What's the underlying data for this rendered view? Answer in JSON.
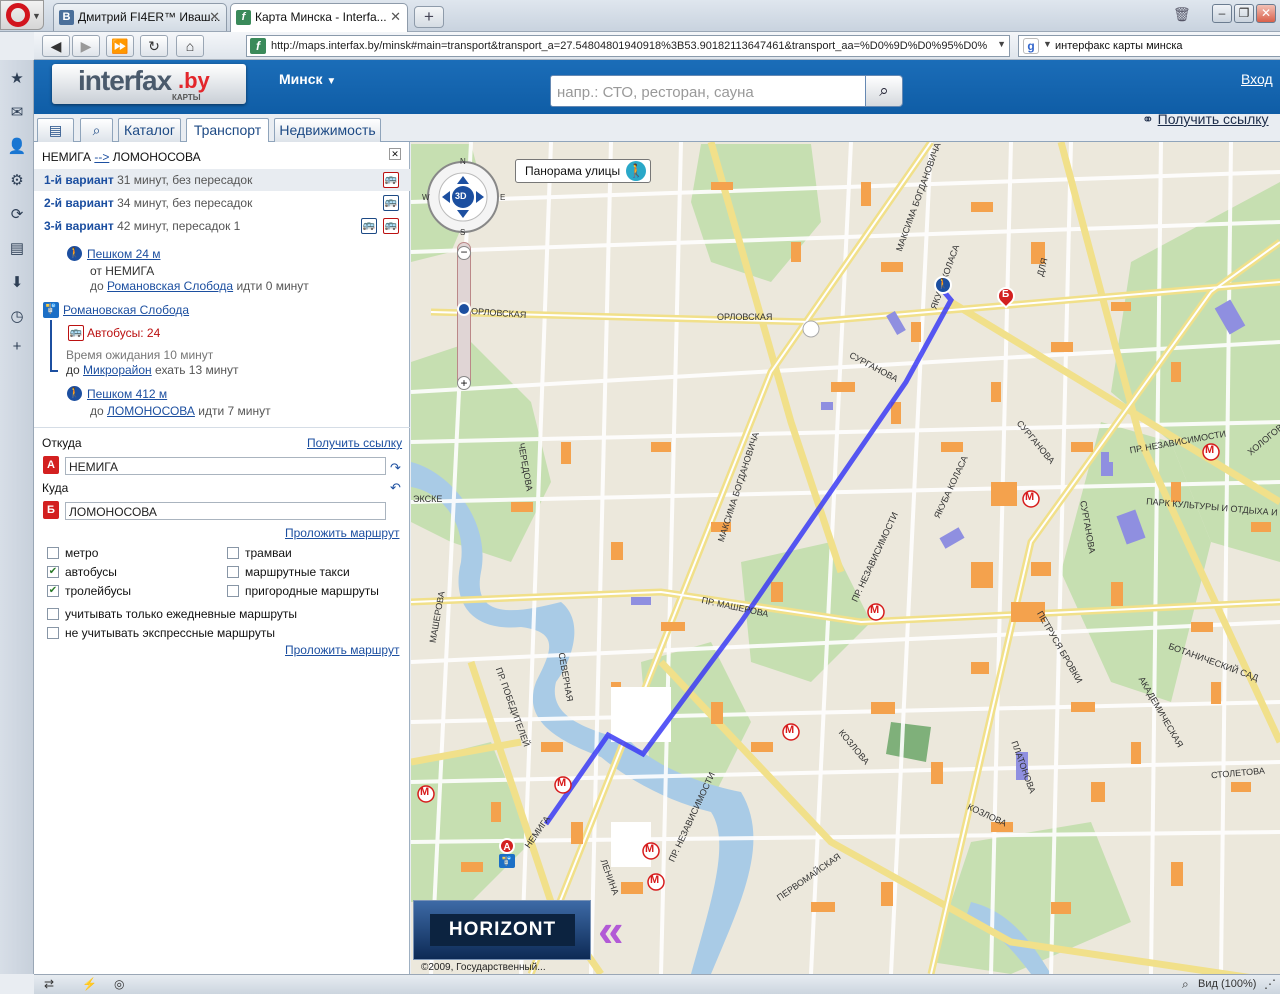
{
  "browser": {
    "tabs": [
      {
        "title": "Дмитрий FI4ER™ Иваш...",
        "favicon": "B"
      },
      {
        "title": "Карта Минска - Interfa...",
        "favicon": "f"
      }
    ],
    "new_tab": "+",
    "address": "http://maps.interfax.by/minsk#main=transport&transport_a=27.5480480194091​8%3B53.90182113647461&transport_aa=%D0%9D%D0%95%D0%",
    "search_query": "интерфакс карты минска",
    "zoom_label": "Вид (100%)"
  },
  "site": {
    "logo_text": "interfax",
    "logo_domain": ".by",
    "logo_sub": "КАРТЫ",
    "city": "Минск",
    "search_placeholder": "напр.: СТО, ресторан, сауна",
    "login": "Вход",
    "tabs": [
      "Каталог",
      "Транспорт",
      "Недвижимость"
    ],
    "active_tab": "Транспорт",
    "get_link": "Получить ссылку"
  },
  "route": {
    "title_from": "НЕМИГА",
    "title_arrow": "-->",
    "title_to": "ЛОМОНОСОВА",
    "variants": [
      {
        "name": "1-й вариант",
        "desc": "31 минут, без пересадок"
      },
      {
        "name": "2-й вариант",
        "desc": "34 минут, без пересадок"
      },
      {
        "name": "3-й вариант",
        "desc": "42 минут, пересадок 1"
      }
    ],
    "steps": {
      "walk1_link": "Пешком 24 м",
      "walk1_from": "от НЕМИГА",
      "walk1_to_prefix": "до",
      "walk1_to": "Романовская Слобода",
      "walk1_suffix": "идти 0 минут",
      "stop_name": "Романовская Слобода",
      "bus_label": "Автобусы: 24",
      "wait_label": "Время ожидания 10 минут",
      "ride_to_prefix": "до",
      "ride_to": "Микрорайон",
      "ride_suffix": "ехать 13 минут",
      "walk2_link": "Пешком 412 м",
      "walk2_to_prefix": "до",
      "walk2_to": "ЛОМОНОСОВА",
      "walk2_suffix": "идти 7 минут"
    }
  },
  "form": {
    "from_label": "Откуда",
    "get_link": "Получить ссылку",
    "from_pin": "А",
    "from_value": "НЕМИГА",
    "to_label": "Куда",
    "to_pin": "Б",
    "to_value": "ЛОМОНОСОВА",
    "build_route": "Проложить маршрут",
    "options": [
      {
        "label": "метро",
        "checked": false
      },
      {
        "label": "трамваи",
        "checked": false
      },
      {
        "label": "автобусы",
        "checked": true
      },
      {
        "label": "маршрутные такси",
        "checked": false
      },
      {
        "label": "тролейбусы",
        "checked": true
      },
      {
        "label": "пригородные маршруты",
        "checked": false
      },
      {
        "label": "учитывать только ежедневные маршруты",
        "checked": false
      },
      {
        "label": "не учитывать экспрессные маршруты",
        "checked": false
      }
    ]
  },
  "map": {
    "panorama": "Панорама улицы",
    "copyright": "©2009, Государственный...",
    "banner": "HORIZONT",
    "streets": [
      "ОРЛОВСКАЯ",
      "ОРЛОВСКАЯ",
      "СУРГАНОВА",
      "СУРГАНОВА",
      "СУРГАНОВА",
      "МАКСИМА БОГДАНОВИЧА",
      "МАКСИМА БОГДАНОВИЧА",
      "ПР. НЕЗАВИСИМОСТИ",
      "ПР. НЕЗАВИСИМОСТИ",
      "ПР. НЕЗАВИСИМОСТИ",
      "ПР. МАШЕРОВА",
      "МАШЕРОВА",
      "ЯКУБА КОЛАСА",
      "ЯКУБА КОЛАСА",
      "ПЕТРУСЯ БРОВКИ",
      "АКАДЕМИЧЕСКАЯ",
      "ПЛАТОНОВА",
      "КОЗЛОВА",
      "КОЗЛОВА",
      "СТОЛЕТОВА",
      "ЛЕНИНА",
      "НЕМИГА",
      "ПР. ПОБЕДИТЕЛЕЙ",
      "СЕВЕРНАЯ",
      "ПЕРВОМАЙСКАЯ",
      "ПАРК КУЛЬТУРЫ И ОТДЫХА И",
      "БОТАНИЧЕСКИЙ САД",
      "ЧЕРЕДОВА",
      "ДЛЯ",
      "ЭКСКЕ",
      "ХОЛОГОВСКАЯ"
    ],
    "metro_symbol": "М",
    "pin_a": "А",
    "pin_b": "Б",
    "compass": {
      "n": "N",
      "s": "S",
      "e": "E",
      "w": "W",
      "center": "3D"
    },
    "colors": {
      "route": "#3b3bf5",
      "building": "#f4a24d",
      "park": "#c6dfb1",
      "water": "#a9cbe6",
      "road": "#fbfbf2",
      "metro": "#d71c1c"
    }
  }
}
